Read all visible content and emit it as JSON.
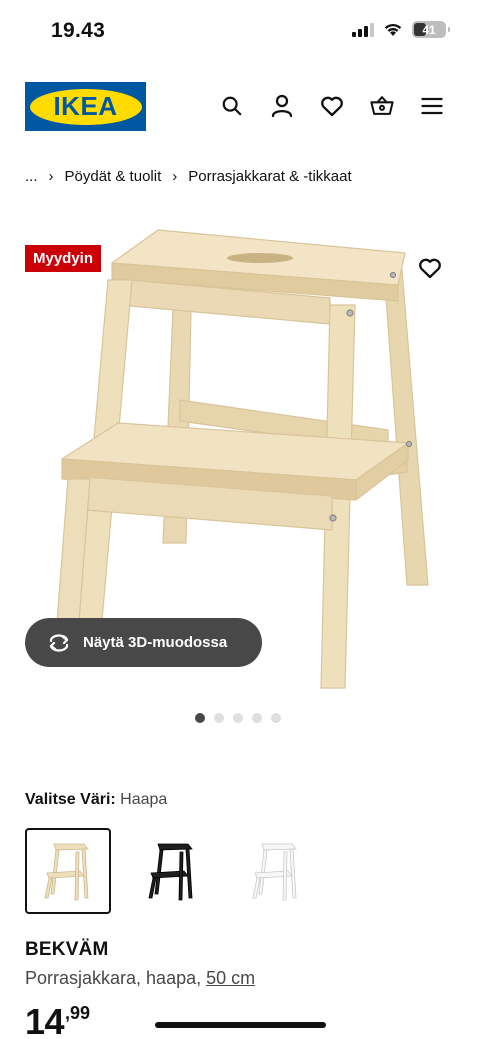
{
  "status_bar": {
    "time": "19.43",
    "battery": "41",
    "battery_level": 0.41
  },
  "header": {
    "logo_text": "IKEA",
    "icons": [
      "search-icon",
      "user-icon",
      "heart-icon",
      "basket-icon",
      "menu-icon"
    ]
  },
  "breadcrumb": {
    "ellipsis": "...",
    "items": [
      "Pöydät & tuolit",
      "Porrasjakkarat & -tikkaat"
    ]
  },
  "product_image": {
    "badge": "Myydyin",
    "view_3d_label": "Näytä 3D-muodossa",
    "carousel_count": 5,
    "carousel_active": 1
  },
  "color_select": {
    "label": "Valitse Väri:",
    "value": "Haapa",
    "options": [
      "wood",
      "black",
      "white"
    ],
    "selected": "wood"
  },
  "product": {
    "name": "BEKVÄM",
    "description": "Porrasjakkara, haapa, ",
    "size": "50 cm",
    "price_int": "14",
    "price_dec": ",99"
  },
  "colors": {
    "ikea_blue": "#0058a3",
    "ikea_yellow": "#ffdb00",
    "badge_red": "#cc0008",
    "wood": "#ecdcb8",
    "pill_bg": "#484848"
  }
}
